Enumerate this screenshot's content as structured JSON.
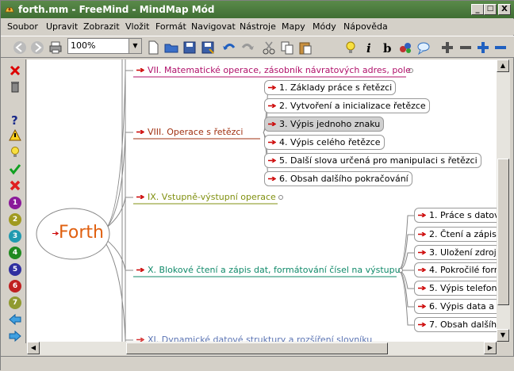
{
  "window": {
    "title": "forth.mm - FreeMind - MindMap Mód",
    "minimize": "_",
    "maximize": "□",
    "close": "X"
  },
  "menu": [
    "Soubor",
    "Upravit",
    "Zobrazit",
    "Vložit",
    "Formát",
    "Navigovat",
    "Nástroje",
    "Mapy",
    "Módy",
    "Nápověda"
  ],
  "toolbar": {
    "zoom_value": "100%"
  },
  "left_icons": [
    "close-icon",
    "trash-icon",
    "help-icon",
    "warning-icon",
    "idea-icon",
    "ok-icon",
    "cancel-icon",
    "priority-1-icon",
    "priority-2-icon",
    "priority-3-icon",
    "priority-4-icon",
    "priority-5-icon",
    "priority-6-icon",
    "priority-7-icon",
    "back-icon",
    "forward-icon"
  ],
  "left_priorities": [
    "1",
    "2",
    "3",
    "4",
    "5",
    "6",
    "7"
  ],
  "colors": {
    "root": "#e06010",
    "vii": "#b0106a",
    "viii": "#a03010",
    "ix": "#809010",
    "x": "#108a6a",
    "arrow": "#cc0000"
  },
  "map": {
    "root": "Forth",
    "branches": {
      "vii": "VII. Matematické operace, zásobník návratových adres, pole",
      "viii": "VIII. Operace s řetězci",
      "ix": "IX. Vstupně-výstupní operace",
      "x": "X. Blokové čtení a zápis dat, formátování čísel na výstupu",
      "xi": "XI. Dynamické datové struktury a rozšíření slovníku"
    },
    "viii_children": [
      "1. Základy práce s řetězci",
      "2. Vytvoření a inicializace řetězce",
      "3. Výpis jednoho znaku",
      "4. Výpis celého řetězce",
      "5. Další slova určená pro manipulaci s řetězci",
      "6. Obsah dalšího pokračování"
    ],
    "x_children": [
      "1. Práce s datov",
      "2. Čtení a zápis",
      "3. Uložení zdroj",
      "4. Pokročilé form",
      "5. Výpis telefonn",
      "6. Výpis data a č",
      "7. Obsah dalšího"
    ]
  }
}
